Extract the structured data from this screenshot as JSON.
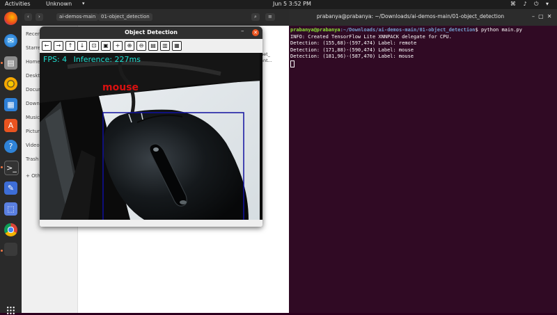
{
  "topbar": {
    "activities": "Activities",
    "app_name": "Unknown",
    "clock": "Jun 5  3:52 PM"
  },
  "files": {
    "tab1": "ai-demos-main",
    "tab2": "01-object_detection",
    "side_items": [
      "Recent",
      "Starred",
      "Home",
      "Desktop",
      "Documents",
      "Downloads",
      "Music",
      "Pictures",
      "Videos",
      "Trash",
      "+ Other Locations"
    ],
    "frag1": "net_",
    "frag2": "ant..."
  },
  "terminal": {
    "title": "prabanya@prabanya: ~/Downloads/ai-demos-main/01-object_detection",
    "prompt_user": "prabanya@prabanya",
    "prompt_path": ":~/Downloads/ai-demos-main/01-object_detection",
    "command": "$ python main.py",
    "lines": [
      "INFO: Created TensorFlow Lite XNNPACK delegate for CPU.",
      "Detection: (155,68)-(597,474) Label: remote",
      "Detection: (171,88)-(590,474) Label: mouse",
      "Detection: (181,96)-(587,470) Label: mouse"
    ]
  },
  "detection_window": {
    "title": "Object Detection",
    "fps_text": "FPS: 4",
    "inference_text": "Inference: 227ms",
    "box_label": "mouse",
    "box_color": "#1010a0",
    "label_color": "#d81010",
    "overlay_color": "#1ee0d2"
  }
}
